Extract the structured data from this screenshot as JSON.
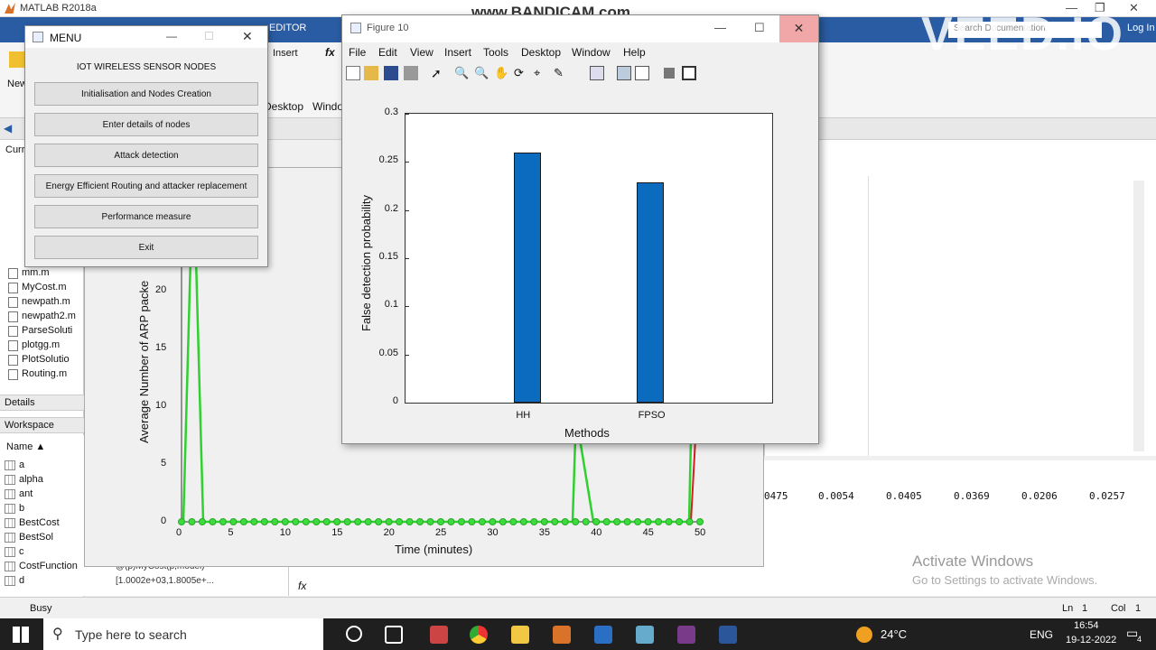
{
  "app_title": "MATLAB R2018a",
  "recorder_watermark": "www.BANDICAM.com",
  "overlay_watermark": "VEED.IO",
  "ribbon": {
    "editor_tab": "EDITOR",
    "insert_label": "Insert",
    "new_label": "New",
    "fx_label": "fx",
    "search_placeholder": "Search Documentation",
    "signin": "Log In",
    "desktop_label": "Desktop",
    "window_label": "Windo"
  },
  "left_panel": {
    "current_folder": "Curr",
    "files": [
      "mm.m",
      "MyCost.m",
      "newpath.m",
      "newpath2.m",
      "ParseSoluti",
      "plotgg.m",
      "PlotSolutio",
      "Routing.m"
    ],
    "details_label": "Details",
    "workspace_label": "Workspace",
    "name_col": "Name ▲"
  },
  "workspace": {
    "vars": [
      {
        "name": "a",
        "value": ""
      },
      {
        "name": "alpha",
        "value": ""
      },
      {
        "name": "ant",
        "value": ""
      },
      {
        "name": "b",
        "value": ""
      },
      {
        "name": "BestCost",
        "value": ""
      },
      {
        "name": "BestSol",
        "value": ""
      },
      {
        "name": "c",
        "value": ""
      },
      {
        "name": "CostFunction",
        "value": "@(p)MyCost(p,model)"
      },
      {
        "name": "d",
        "value": "[1.0002e+03,1.8005e+..."
      }
    ]
  },
  "command_window": {
    "numbers": [
      "0475",
      "0.0054",
      "0.0405",
      "0.0369",
      "0.0206",
      "0.0257"
    ],
    "fx": "fx"
  },
  "activate": {
    "title": "Activate Windows",
    "subtitle": "Go to Settings to activate Windows."
  },
  "statusbar": {
    "busy": "Busy",
    "ln": "Ln",
    "ln_val": "1",
    "col": "Col",
    "col_val": "1"
  },
  "bg_plot": {
    "ylabel": "Average Number of ARP packe",
    "xlabel": "Time (minutes)",
    "yticks": [
      "0",
      "5",
      "10",
      "15",
      "20"
    ],
    "xticks": [
      "0",
      "5",
      "10",
      "15",
      "20",
      "25",
      "30",
      "35",
      "40",
      "45",
      "50"
    ]
  },
  "menu_window": {
    "title": "MENU",
    "heading": "IOT WIRELESS SENSOR NODES",
    "buttons": [
      "Initialisation and Nodes Creation",
      "Enter details of nodes",
      "Attack detection",
      "Energy Efficient Routing and attacker replacement",
      "Performance measure",
      "Exit"
    ]
  },
  "figure10": {
    "title": "Figure 10",
    "menu": [
      "File",
      "Edit",
      "View",
      "Insert",
      "Tools",
      "Desktop",
      "Window",
      "Help"
    ]
  },
  "chart_data": {
    "type": "bar",
    "categories": [
      "HH",
      "FPSO"
    ],
    "values": [
      0.26,
      0.229
    ],
    "title": "",
    "xlabel": "Methods",
    "ylabel": "False detection probability",
    "ylim": [
      0,
      0.3
    ],
    "yticks": [
      "0",
      "0.05",
      "0.1",
      "0.15",
      "0.2",
      "0.25",
      "0.3"
    ],
    "bar_color": "#0b6bbf",
    "grid": false
  },
  "taskbar": {
    "search": "Type here to search",
    "temp": "24°C",
    "lang": "ENG",
    "time": "16:54",
    "date": "19-12-2022",
    "notif": "4"
  }
}
